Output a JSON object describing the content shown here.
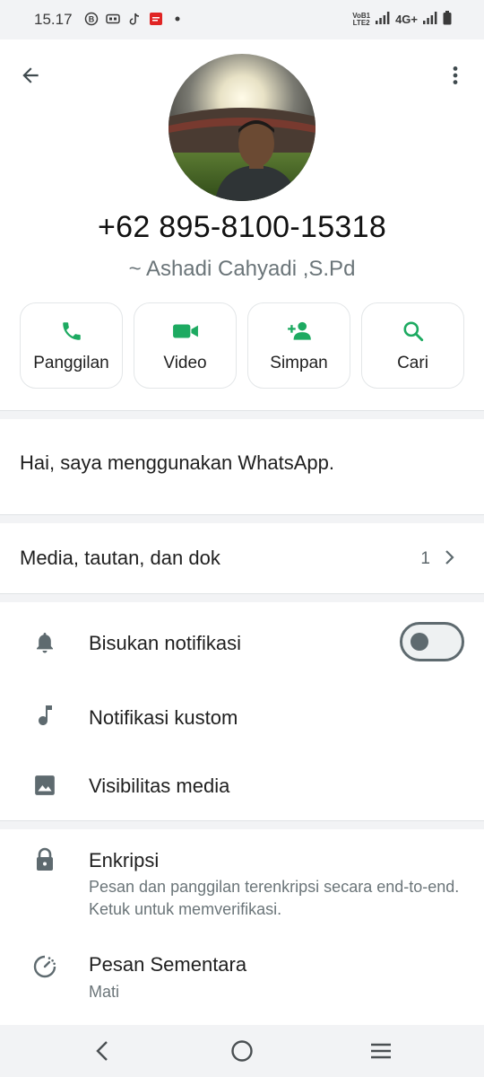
{
  "status_bar": {
    "time": "15.17",
    "volte_top": "VoB1",
    "volte_bottom": "LTE2",
    "network": "4G+"
  },
  "header": {
    "back_icon": "arrow-left-icon",
    "more_icon": "more-vertical-icon",
    "phone_number": "+62 895-8100-15318",
    "push_name": "~ Ashadi Cahyadi ,S.Pd"
  },
  "actions": [
    {
      "label": "Panggilan",
      "icon": "phone-icon"
    },
    {
      "label": "Video",
      "icon": "video-icon"
    },
    {
      "label": "Simpan",
      "icon": "add-contact-icon"
    },
    {
      "label": "Cari",
      "icon": "search-icon"
    }
  ],
  "about": {
    "text": "Hai, saya menggunakan WhatsApp."
  },
  "media": {
    "label": "Media, tautan, dan dok",
    "count": "1"
  },
  "settings": {
    "mute": {
      "label": "Bisukan notifikasi",
      "enabled": false
    },
    "custom": {
      "label": "Notifikasi kustom"
    },
    "visibility": {
      "label": "Visibilitas media"
    }
  },
  "security": {
    "encryption_title": "Enkripsi",
    "encryption_sub": "Pesan dan panggilan terenkripsi secara end-to-end. Ketuk untuk memverifikasi.",
    "disappearing_title": "Pesan Sementara",
    "disappearing_sub": "Mati"
  },
  "colors": {
    "accent": "#1daa61",
    "icon_gray": "#5e6a6f",
    "divider_bg": "#f2f3f5"
  }
}
